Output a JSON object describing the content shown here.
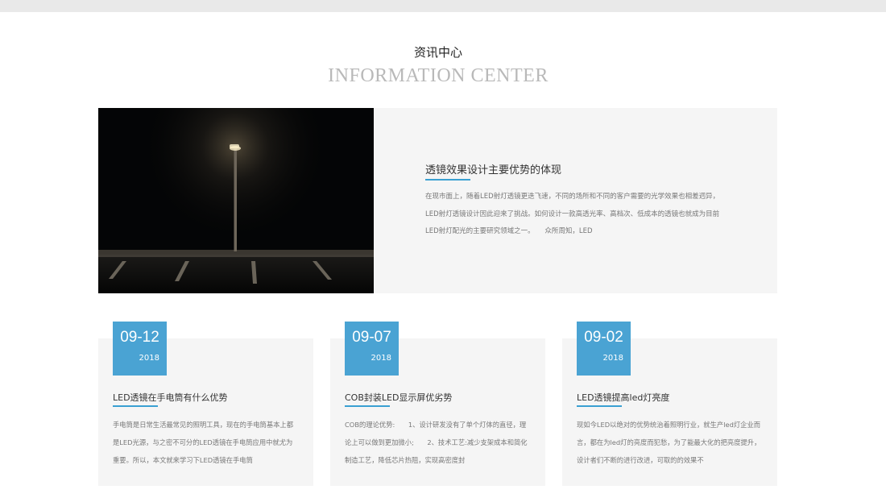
{
  "header": {
    "title": "资讯中心",
    "subtitle": "INFORMATION CENTER"
  },
  "featured": {
    "title": "透镜效果设计主要优势的体现",
    "excerpt": "在现市面上，随着LED射灯透镜更迭飞速，不同的场所和不同的客户需要的光学效果也相差迥异，LED射灯透镜设计因此迎来了挑战。如何设计一款高透光率、高档次、低成本的透镜也就成为目前LED射灯配光的主要研究领域之一。　　众所周知，LED"
  },
  "news": [
    {
      "date_md": "09-12",
      "year": "2018",
      "title": "LED透镜在手电筒有什么优势",
      "excerpt": "手电筒是日常生活最常见的照明工具，现在的手电筒基本上都是LED光源，与之密不可分的LED透镜在手电筒应用中就尤为重要。所以，本文就来学习下LED透镜在手电筒"
    },
    {
      "date_md": "09-07",
      "year": "2018",
      "title": "COB封装LED显示屏优劣势",
      "excerpt": "COB的理论优势:　　1、设计研发没有了单个灯体的直径，理论上可以做到更加微小;　　2、技术工艺:减少支架成本和简化制造工艺，降低芯片热阻，实现高密度封"
    },
    {
      "date_md": "09-02",
      "year": "2018",
      "title": "LED透镜提高led灯亮度",
      "excerpt": "现如今LED以绝对的优势统治着照明行业，就生产led灯企业而言，都在为led灯的亮度而犯愁，为了能最大化的把亮度提升，设计者们不断的进行改进，可取的的效果不"
    }
  ],
  "colors": {
    "accent": "#4aa3d3",
    "underline": "#3aa0d2",
    "card_bg": "#f5f5f5"
  }
}
